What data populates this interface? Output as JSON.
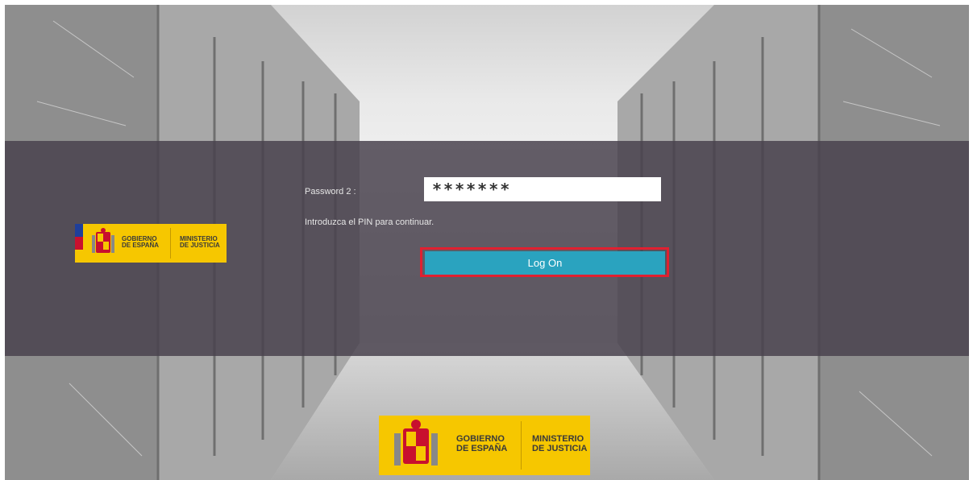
{
  "login": {
    "password_label": "Password 2 :",
    "password_value": "*******",
    "pin_hint": "Introduzca el PIN para continuar.",
    "logon_label": "Log On"
  },
  "logo_small": {
    "line1": "GOBIERNO",
    "line2": "DE ESPAÑA",
    "line3": "MINISTERIO",
    "line4": "DE JUSTICIA"
  },
  "logo_big": {
    "line1": "GOBIERNO",
    "line2": "DE ESPAÑA",
    "line3": "MINISTERIO",
    "line4": "DE JUSTICIA"
  },
  "colors": {
    "band": "#48404c",
    "button": "#2aa3bf",
    "highlight": "#e02030",
    "logo_yellow": "#f6c700",
    "eu_blue": "#1f3f9a",
    "spain_red": "#c8102e"
  },
  "icons": [
    "coat-of-arms-icon",
    "eu-stripe-icon"
  ]
}
